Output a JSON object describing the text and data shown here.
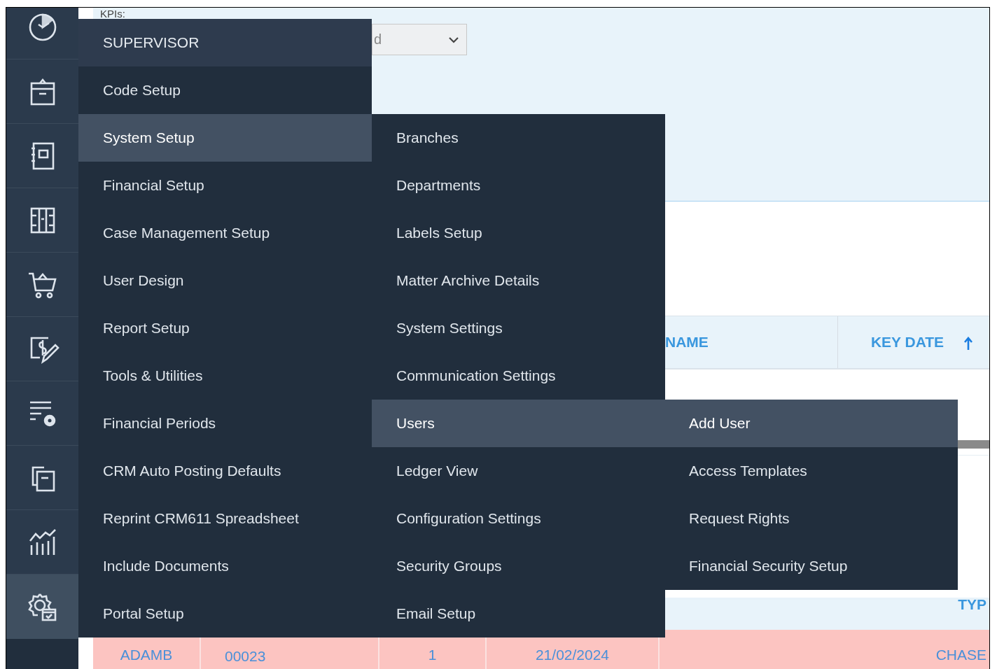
{
  "kpi_panel": {
    "label": "KPIs:",
    "select": {
      "value": "d"
    }
  },
  "sidebar": {
    "items": [
      {
        "selected": false
      },
      {
        "selected": false
      },
      {
        "selected": false
      },
      {
        "selected": false
      },
      {
        "selected": false
      },
      {
        "selected": false
      },
      {
        "selected": false
      },
      {
        "selected": false
      },
      {
        "selected": false
      },
      {
        "selected": true
      }
    ]
  },
  "menu": {
    "header": "SUPERVISOR",
    "items": [
      {
        "label": "Code Setup",
        "selected": false
      },
      {
        "label": "System Setup",
        "selected": true
      },
      {
        "label": "Financial Setup",
        "selected": false
      },
      {
        "label": "Case Management Setup",
        "selected": false
      },
      {
        "label": "User Design",
        "selected": false
      },
      {
        "label": "Report Setup",
        "selected": false
      },
      {
        "label": "Tools & Utilities",
        "selected": false
      },
      {
        "label": "Financial Periods",
        "selected": false
      },
      {
        "label": "CRM Auto Posting Defaults",
        "selected": false
      },
      {
        "label": "Reprint CRM611 Spreadsheet",
        "selected": false
      },
      {
        "label": "Include Documents",
        "selected": false
      },
      {
        "label": "Portal Setup",
        "selected": false
      }
    ]
  },
  "submenu": {
    "items": [
      {
        "label": "Branches",
        "selected": false
      },
      {
        "label": "Departments",
        "selected": false
      },
      {
        "label": "Labels Setup",
        "selected": false
      },
      {
        "label": "Matter Archive Details",
        "selected": false
      },
      {
        "label": "System Settings",
        "selected": false
      },
      {
        "label": "Communication Settings",
        "selected": false
      },
      {
        "label": "Users",
        "selected": true
      },
      {
        "label": "Ledger View",
        "selected": false
      },
      {
        "label": "Configuration Settings",
        "selected": false
      },
      {
        "label": "Security Groups",
        "selected": false
      },
      {
        "label": "Email Setup",
        "selected": false
      }
    ]
  },
  "submenu_2": {
    "items": [
      {
        "label": "Add User",
        "selected": true
      },
      {
        "label": "Access Templates",
        "selected": false
      },
      {
        "label": "Request Rights",
        "selected": false
      },
      {
        "label": "Financial Security Setup",
        "selected": false
      }
    ]
  },
  "table": {
    "columns": [
      {
        "label": "NAME",
        "sorted": false
      },
      {
        "label": "KEY DATE",
        "sorted": true
      }
    ],
    "second_header": {
      "label": "TYP"
    },
    "rows": [
      {
        "cells": [
          "ADAMB",
          "00023",
          "1",
          "21/02/2024",
          "CHASE"
        ]
      }
    ]
  }
}
